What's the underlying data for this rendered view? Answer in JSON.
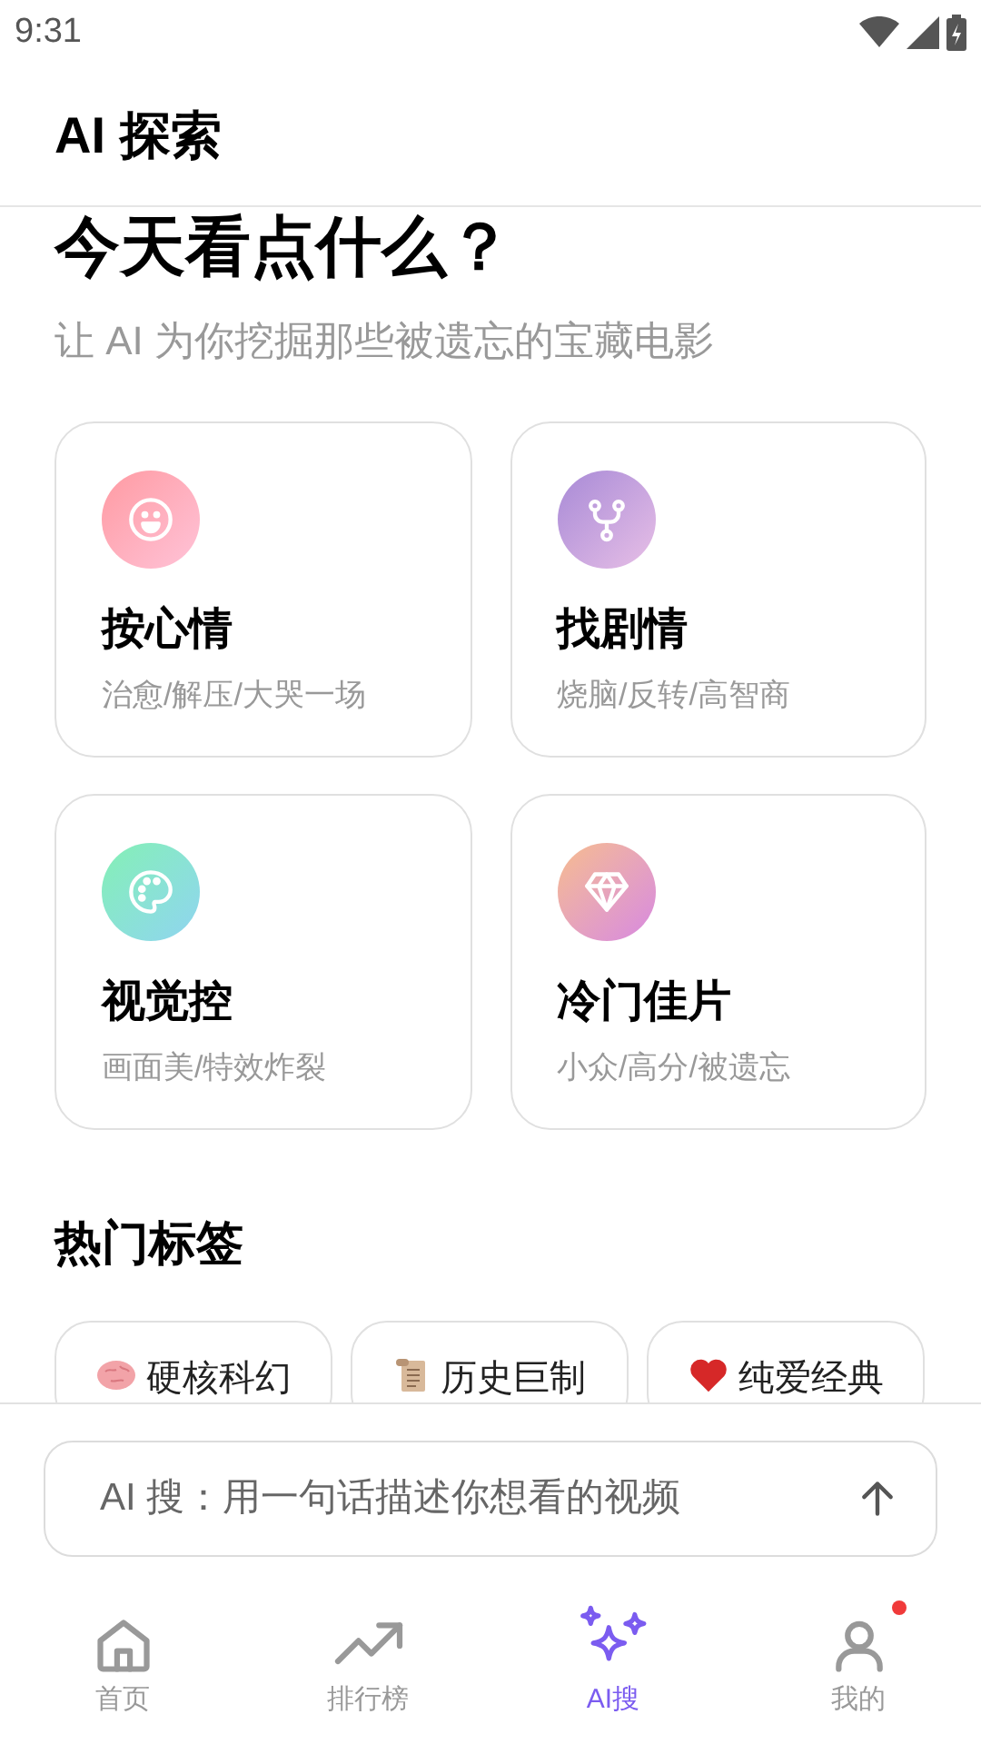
{
  "status_bar": {
    "time": "9:31"
  },
  "header": {
    "title": "AI 探索"
  },
  "hero": {
    "title": "今天看点什么？",
    "subtitle": "让 AI 为你挖掘那些被遗忘的宝藏电影"
  },
  "categories": [
    {
      "kind": "mood",
      "title": "按心情",
      "tags": "治愈/解压/大哭一场"
    },
    {
      "kind": "plot",
      "title": "找剧情",
      "tags": "烧脑/反转/高智商"
    },
    {
      "kind": "visual",
      "title": "视觉控",
      "tags": "画面美/特效炸裂"
    },
    {
      "kind": "gem",
      "title": "冷门佳片",
      "tags": "小众/高分/被遗忘"
    }
  ],
  "hot_tags": {
    "title": "热门标签",
    "items": [
      {
        "kind": "brain",
        "label": "硬核科幻"
      },
      {
        "kind": "scroll",
        "label": "历史巨制"
      },
      {
        "kind": "heart",
        "label": "纯爱经典"
      }
    ]
  },
  "search": {
    "placeholder": "AI 搜：用一句话描述你想看的视频"
  },
  "nav": [
    {
      "kind": "home",
      "label": "首页",
      "selected": false,
      "badge": false
    },
    {
      "kind": "trend",
      "label": "排行榜",
      "selected": false,
      "badge": false
    },
    {
      "kind": "sparkle",
      "label": "AI搜",
      "selected": true,
      "badge": false
    },
    {
      "kind": "user",
      "label": "我的",
      "selected": false,
      "badge": true
    }
  ]
}
